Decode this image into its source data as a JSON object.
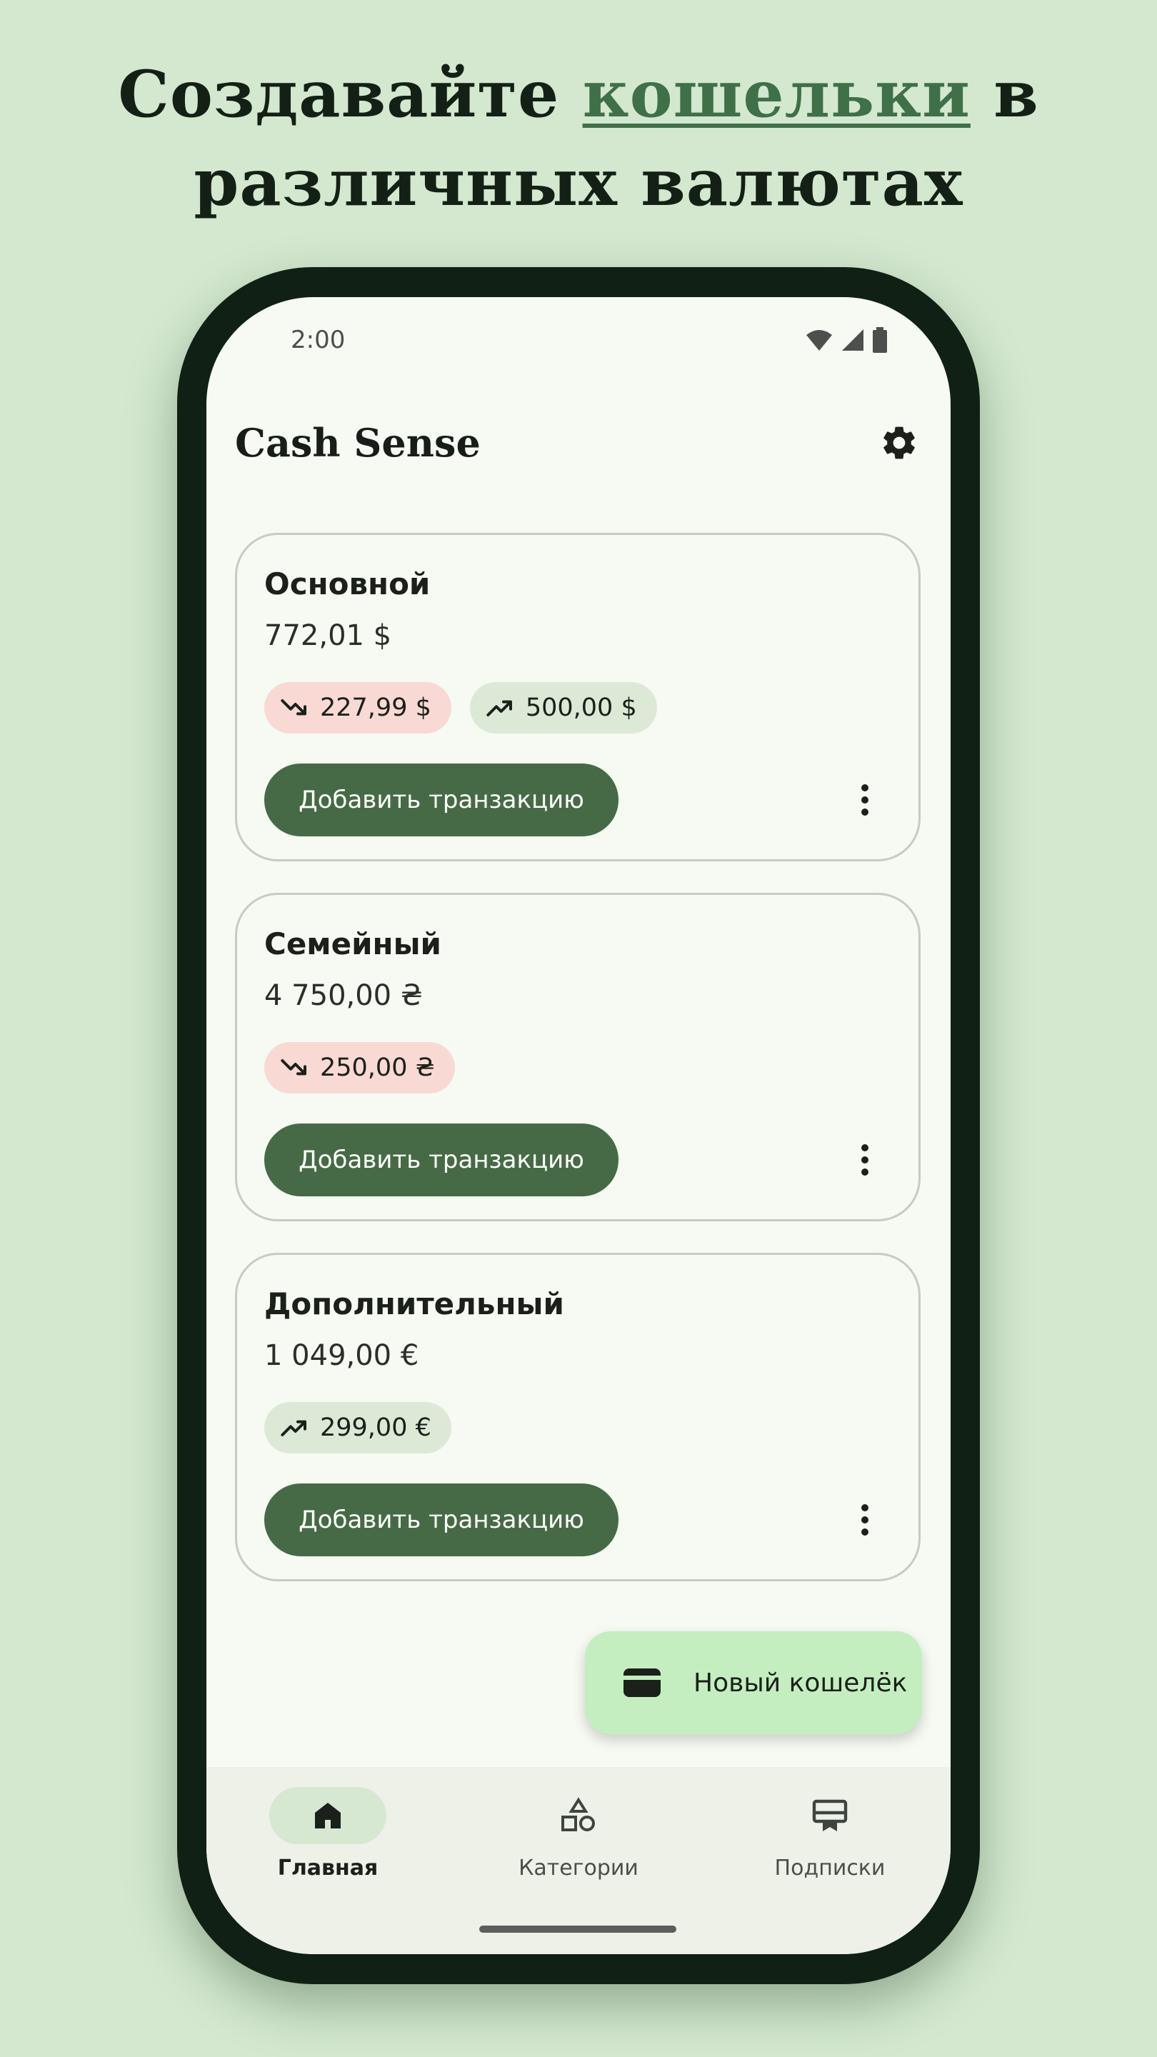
{
  "headline": {
    "line1_before": "Создавайте ",
    "line1_highlight": "кошельки",
    "line1_after": " в",
    "line2": "различных валютах"
  },
  "status_bar": {
    "time": "2:00",
    "icons": [
      "wifi-icon",
      "signal-icon",
      "battery-icon"
    ]
  },
  "app": {
    "title": "Cash Sense",
    "settings_icon": "gear-icon"
  },
  "wallets": [
    {
      "name": "Основной",
      "balance": "772,01 $",
      "expense": "227,99 $",
      "income": "500,00 $",
      "add_label": "Добавить транзакцию"
    },
    {
      "name": "Семейный",
      "balance": "4 750,00 ₴",
      "expense": "250,00 ₴",
      "add_label": "Добавить транзакцию"
    },
    {
      "name": "Дополнительный",
      "balance": "1 049,00 €",
      "income": "299,00 €",
      "add_label": "Добавить транзакцию"
    }
  ],
  "fab": {
    "label": "Новый кошелёк",
    "icon": "wallet-icon"
  },
  "nav": [
    {
      "label": "Главная",
      "icon": "home-icon",
      "active": true
    },
    {
      "label": "Категории",
      "icon": "shapes-icon",
      "active": false
    },
    {
      "label": "Подписки",
      "icon": "subscriptions-icon",
      "active": false
    }
  ],
  "colors": {
    "background": "#d3e8cf",
    "primary": "#466a45",
    "expense_chip": "#f8d9d4",
    "income_chip": "#dce9d7",
    "fab": "#c4eec0",
    "accent_text": "#3f7047"
  }
}
